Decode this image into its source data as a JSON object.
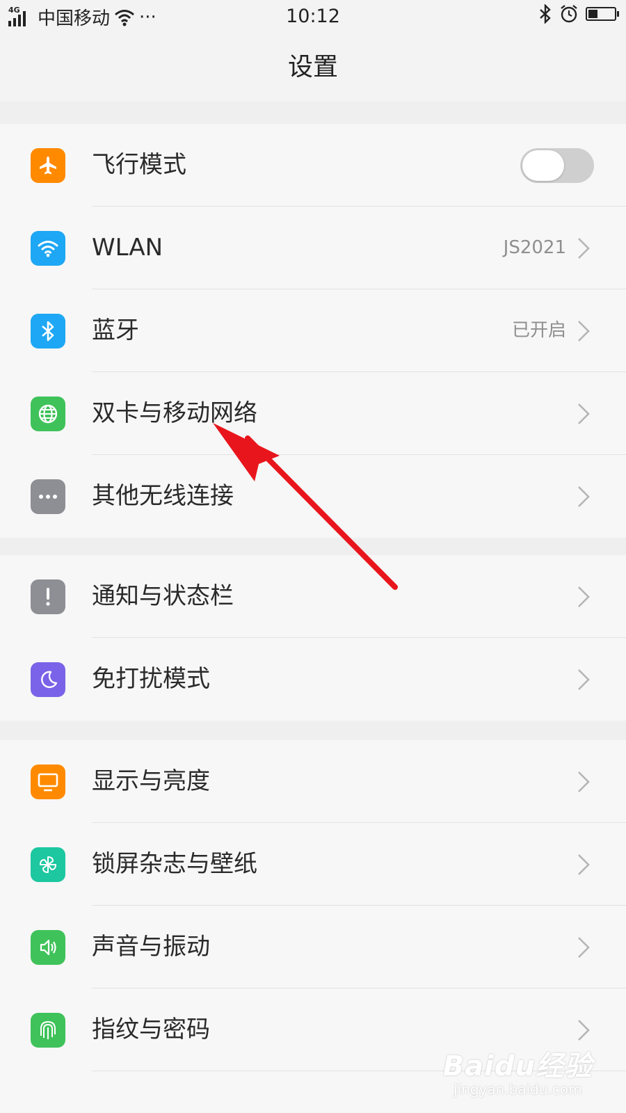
{
  "status_bar": {
    "network_type": "4G",
    "carrier": "中国移动",
    "more": "···",
    "time": "10:12",
    "battery_level": 0.35
  },
  "header": {
    "title": "设置"
  },
  "groups": [
    {
      "items": [
        {
          "label": "飞行模式",
          "icon": "airplane-icon",
          "color": "#ff8a00",
          "toggle": false
        },
        {
          "label": "WLAN",
          "icon": "wifi-icon",
          "color": "#1ea7f4",
          "value": "JS2021"
        },
        {
          "label": "蓝牙",
          "icon": "bluetooth-icon",
          "color": "#1ea7f4",
          "value": "已开启"
        },
        {
          "label": "双卡与移动网络",
          "icon": "globe-icon",
          "color": "#3fc25a"
        },
        {
          "label": "其他无线连接",
          "icon": "more-icon",
          "color": "#8d8f94"
        }
      ]
    },
    {
      "items": [
        {
          "label": "通知与状态栏",
          "icon": "exclamation-icon",
          "color": "#8d8f94"
        },
        {
          "label": "免打扰模式",
          "icon": "moon-icon",
          "color": "#7a63e8"
        }
      ]
    },
    {
      "items": [
        {
          "label": "显示与亮度",
          "icon": "monitor-icon",
          "color": "#ff8a00"
        },
        {
          "label": "锁屏杂志与壁纸",
          "icon": "pinwheel-icon",
          "color": "#1dc7a0"
        },
        {
          "label": "声音与振动",
          "icon": "speaker-icon",
          "color": "#3fc25a"
        },
        {
          "label": "指纹与密码",
          "icon": "fingerprint-icon",
          "color": "#3fc25a"
        }
      ]
    }
  ],
  "watermark": {
    "main": "Baidu经验",
    "sub": "jingyan.baidu.com"
  },
  "annotation": {
    "color": "#e8161c"
  }
}
